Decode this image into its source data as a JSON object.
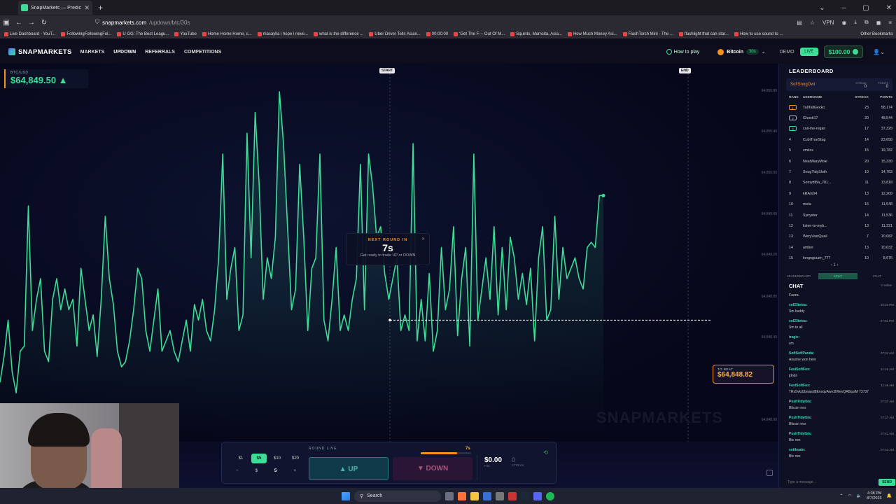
{
  "browser": {
    "tab_title": "SnapMarkets — Predict the Ne",
    "url_host": "snapmarkets.com",
    "url_path": "/updown/btc/30s",
    "vpn_label": "VPN",
    "bookmarks": [
      "Live Dashboard - YouT...",
      "FollowingFollowingFol...",
      "U GG: The Best Leagu...",
      "YouTube",
      "Home Home Home, c...",
      "macaylia i hope i neve...",
      "what is the difference ...",
      "Uber Driver Tells Asian...",
      "00:00:00",
      "'Get The F--- Out Of M...",
      "Squints, Mamcita, Asia...",
      "How Much Money Asi...",
      "FlashTorch Mini - The ...",
      "flashlight that can star...",
      "How to use sound to ..."
    ],
    "other_bookmarks": "Other Bookmarks"
  },
  "header": {
    "brand": "SNAPMARKETS",
    "nav": [
      "MARKETS",
      "UPDOWN",
      "REFERRALS",
      "COMPETITIONS"
    ],
    "how_to_play": "How to play",
    "asset": "Bitcoin",
    "interval": "30s",
    "demo_label": "DEMO",
    "live_label": "LIVE",
    "balance": "$100.00"
  },
  "chart": {
    "pair": "BTC/USD",
    "price": "$64,849.50 ▲",
    "start_label": "START",
    "end_label": "END",
    "next_round_label": "NEXT ROUND IN",
    "countdown": "7s",
    "next_round_sub": "Get ready to trade UP or DOWN",
    "to_beat_label": "TO BEAT",
    "to_beat_value": "$64,848.82",
    "watermark": "SNAPMARKETS",
    "y_ticks": [
      "64,850.80",
      "64,850.40",
      "64,850.00",
      "64,849.60",
      "64,849.20",
      "64,848.80",
      "64,848.40",
      "64,848.00"
    ]
  },
  "chart_data": {
    "type": "line",
    "title": "",
    "xlabel": "",
    "ylabel": "",
    "ylim": [
      64847.9,
      64850.9
    ],
    "grid": false,
    "series": [
      {
        "color": "#3ddc97",
        "values": [
          64848.1,
          64848.35,
          64848.7,
          64848.2,
          64848.0,
          64848.4,
          64848.45,
          64849.8,
          64848.6,
          64848.9,
          64849.1,
          64848.4,
          64848.3,
          64848.9,
          64849.1,
          64848.8,
          64849.0,
          64848.8,
          64848.9,
          64848.45,
          64849.2,
          64848.9,
          64848.6,
          64848.75,
          64848.35,
          64848.9,
          64849.7,
          64849.1,
          64848.85,
          64848.4,
          64848.25,
          64848.3,
          64848.5,
          64848.8,
          64849.2,
          64849.1,
          64848.6,
          64848.4,
          64848.7,
          64849.0,
          64848.4,
          64848.5,
          64848.6,
          64848.4,
          64848.3,
          64848.5,
          64848.7,
          64848.4,
          64848.85,
          64848.7,
          64848.9,
          64848.6,
          64848.5,
          64848.8,
          64849.3,
          64850.3,
          64848.9,
          64849.2,
          64849.4,
          64848.6,
          64848.75,
          64850.5,
          64849.3,
          64850.7,
          64850.0,
          64848.9,
          64849.3,
          64849.1,
          64849.5,
          64850.9,
          64850.4,
          64849.6,
          64848.8,
          64849.0,
          64850.2,
          64849.5,
          64848.6,
          64849.2,
          64849.3,
          64850.3,
          64848.7,
          64848.5,
          64848.9,
          64849.4,
          64848.6,
          64848.75,
          64848.6,
          64848.9,
          64849.1,
          64850.2,
          64848.8,
          64850.3,
          64850.0,
          64849.5,
          64849.6,
          64849.15,
          64848.9,
          64849.1,
          64849.3,
          64848.6,
          64848.75,
          64848.6,
          64850.4,
          64848.5,
          64848.9,
          64848.5,
          64849.15,
          64848.4,
          64848.6,
          64849.4,
          64848.8,
          64849.0,
          64849.6,
          64848.55,
          64849.1,
          64849.4,
          64848.45,
          64850.3,
          64848.7,
          64849.0,
          64849.3,
          64848.9,
          64849.6,
          64848.75,
          64849.4,
          64848.8,
          64849.5,
          64849.3,
          64848.9,
          64849.15,
          64848.85,
          64849.2,
          64848.5,
          64849.3,
          64849.6,
          64848.7,
          64848.8,
          64849.7,
          64848.9,
          64849.4,
          64849.1,
          64849.2,
          64849.3,
          64849.1,
          64849.0,
          64849.4,
          64849.45,
          64849.4,
          64849.9,
          64849.9
        ]
      }
    ]
  },
  "trade": {
    "amounts": [
      "$1",
      "$5",
      "$10",
      "$20"
    ],
    "minus": "−",
    "plus": "+",
    "currency": "$",
    "amount_value": "5",
    "round_live_label": "ROUND LIVE",
    "round_time": "7s",
    "round_progress": 0.72,
    "up_label": "▲ UP",
    "down_label": "▼ DOWN",
    "payout_value": "$0.00",
    "payout_label": "P&L",
    "streak_value": "0",
    "streak_label": "STREAK"
  },
  "leaderboard": {
    "title": "LEADERBOARD",
    "me_name": "SoftSnugOwl",
    "me_streak_label": "STREAK",
    "me_streak": "0",
    "me_points_label": "POINTS",
    "me_points": "0",
    "headers": [
      "RANK",
      "USERNAME",
      "STREAK",
      "POINTS"
    ],
    "rows": [
      {
        "rank": "1",
        "user": "TallTallGecko",
        "streak": "23",
        "points": "58,174"
      },
      {
        "rank": "2",
        "user": "Ghostt17",
        "streak": "20",
        "points": "48,544"
      },
      {
        "rank": "3",
        "user": "call-me-regan",
        "streak": "17",
        "points": "37,329"
      },
      {
        "rank": "4",
        "user": "CubiTrueStag",
        "streak": "14",
        "points": "23,658"
      },
      {
        "rank": "5",
        "user": "smkxx",
        "streak": "15",
        "points": "19,782"
      },
      {
        "rank": "6",
        "user": "NeatWaryMole",
        "streak": "20",
        "points": "15,339"
      },
      {
        "rank": "7",
        "user": "SnugTidySloth",
        "streak": "10",
        "points": "14,763"
      },
      {
        "rank": "8",
        "user": "SomydiBa_781...",
        "streak": "11",
        "points": "13,818"
      },
      {
        "rank": "9",
        "user": "kRAm04",
        "streak": "13",
        "points": "12,209"
      },
      {
        "rank": "10",
        "user": "meta",
        "streak": "16",
        "points": "11,548"
      },
      {
        "rank": "11",
        "user": "Synyster",
        "streak": "14",
        "points": "11,536"
      },
      {
        "rank": "12",
        "user": "listen-to-myb...",
        "streak": "13",
        "points": "11,221"
      },
      {
        "rank": "13",
        "user": "WaryVastQuail",
        "streak": "7",
        "points": "10,082"
      },
      {
        "rank": "14",
        "user": "amber",
        "streak": "13",
        "points": "10,032"
      },
      {
        "rank": "15",
        "user": "longnguuen_777",
        "streak": "10",
        "points": "8,676"
      }
    ],
    "pager": "‹ 1 ›",
    "tabs": [
      "LEADERBOARD",
      "SPLIT",
      "CHAT"
    ]
  },
  "chat": {
    "title": "CHAT",
    "online": "3 online",
    "first_line": "Fazza.",
    "messages": [
      {
        "user": "sol23tetsu:",
        "time": "10:16 PM",
        "text": "Sm buddy"
      },
      {
        "user": "sol23tetsu:",
        "time": "07:01 PM",
        "text": "Sm to all"
      },
      {
        "user": "tragic:",
        "time": "",
        "text": "sm"
      },
      {
        "user": "SoftSoftPanda:",
        "time": "07:34 AM",
        "text": "Anyone won here"
      },
      {
        "user": "FastSoftFox:",
        "time": "11:45 AM",
        "text": "jdndn"
      },
      {
        "user": "FastSoftFox:",
        "time": "11:46 AM",
        "text": "TRs5vkdJbwasd8EnoqvAwrc8WevQABquiM 73737"
      },
      {
        "user": "PoshTidyIbis:",
        "time": "07:37 AM",
        "text": "Bitcoin nex"
      },
      {
        "user": "PoshTidyIbis:",
        "time": "07:37 AM",
        "text": "Bitcoin nex"
      },
      {
        "user": "PoshTidyIbis:",
        "time": "07:41 AM",
        "text": "Btc nex"
      },
      {
        "user": "sotikoain:",
        "time": "07:43 AM",
        "text": "Btc nex"
      }
    ],
    "input_placeholder": "Type a message...",
    "send_label": "SEND"
  },
  "taskbar": {
    "search_label": "Search",
    "time": "4:08 PM",
    "date": "8/7/2026"
  }
}
